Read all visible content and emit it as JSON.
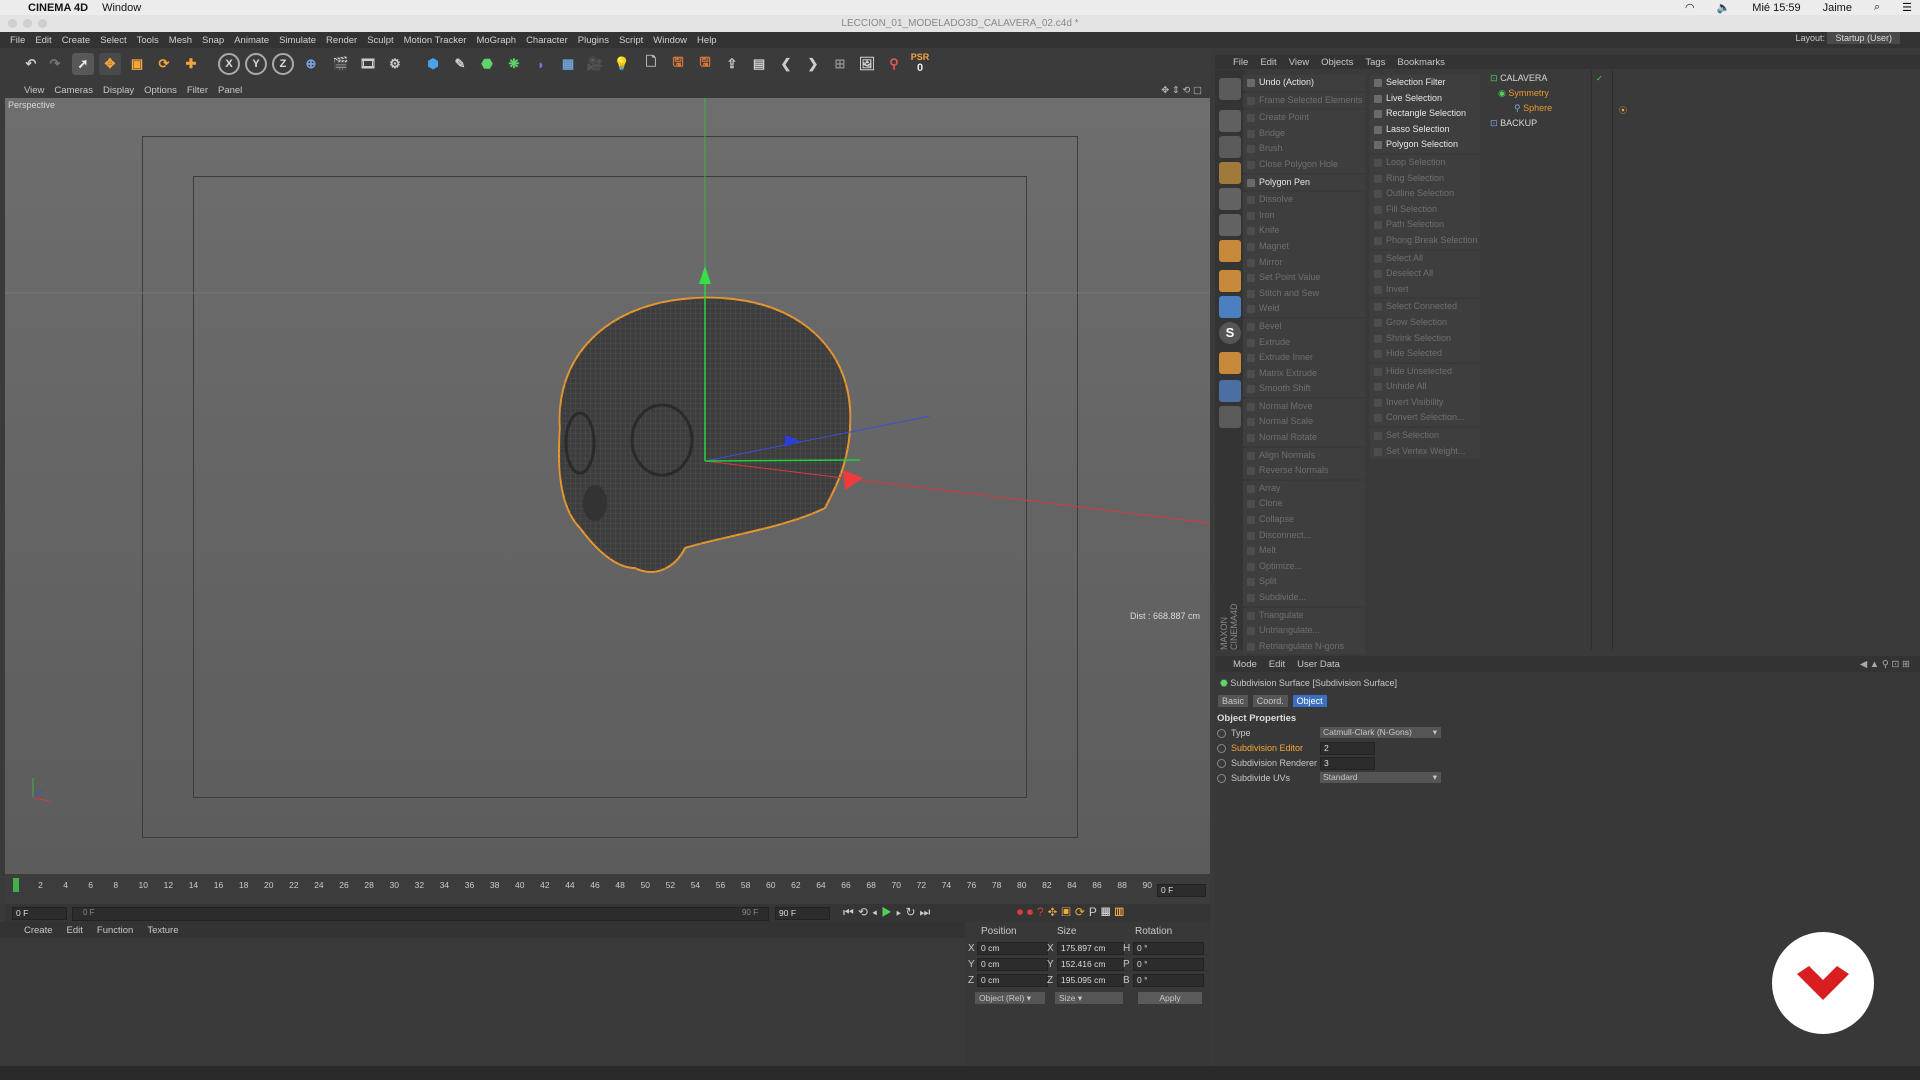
{
  "mac": {
    "app_name": "CINEMA 4D",
    "menu_window": "Window",
    "clock": "Mié 15:59",
    "user": "Jaime"
  },
  "window": {
    "title": "LECCION_01_MODELADO3D_CALAVERA_02.c4d *"
  },
  "app_menu": [
    "File",
    "Edit",
    "Create",
    "Select",
    "Tools",
    "Mesh",
    "Snap",
    "Animate",
    "Simulate",
    "Render",
    "Sculpt",
    "Motion Tracker",
    "MoGraph",
    "Character",
    "Plugins",
    "Script",
    "Window",
    "Help"
  ],
  "layout": {
    "label": "Layout:",
    "value": "Startup (User)"
  },
  "toolbar": {
    "psr_label": "PSR",
    "psr_value": "0"
  },
  "viewport_menu": [
    "View",
    "Cameras",
    "Display",
    "Options",
    "Filter",
    "Panel"
  ],
  "viewport": {
    "name": "Perspective",
    "distance": "Dist : 668.887 cm"
  },
  "timeline": {
    "ticks": [
      "0",
      "2",
      "4",
      "6",
      "8",
      "10",
      "12",
      "14",
      "16",
      "18",
      "20",
      "22",
      "24",
      "26",
      "28",
      "30",
      "32",
      "34",
      "36",
      "38",
      "40",
      "42",
      "44",
      "46",
      "48",
      "50",
      "52",
      "54",
      "56",
      "58",
      "60",
      "62",
      "64",
      "66",
      "68",
      "70",
      "72",
      "74",
      "76",
      "78",
      "80",
      "82",
      "84",
      "86",
      "88",
      "90"
    ],
    "current_frame": "0 F",
    "start": "0 F",
    "range_start": "0 F",
    "range_end": "90 F",
    "end": "90 F"
  },
  "material_menu": [
    "Create",
    "Edit",
    "Function",
    "Texture"
  ],
  "coords": {
    "headers": [
      "Position",
      "Size",
      "Rotation"
    ],
    "rows": [
      {
        "axis": "X",
        "pos": "0 cm",
        "saxis": "X",
        "size": "175.897 cm",
        "raxis": "H",
        "rot": "0 °"
      },
      {
        "axis": "Y",
        "pos": "0 cm",
        "saxis": "Y",
        "size": "152.416 cm",
        "raxis": "P",
        "rot": "0 °"
      },
      {
        "axis": "Z",
        "pos": "0 cm",
        "saxis": "Z",
        "size": "195.095 cm",
        "raxis": "B",
        "rot": "0 °"
      }
    ],
    "mode": "Object (Rel)",
    "size_mode": "Size",
    "apply": "Apply"
  },
  "right_menu": [
    "File",
    "Edit",
    "View",
    "Objects",
    "Tags",
    "Bookmarks"
  ],
  "mesh_commands": {
    "col1": [
      {
        "label": "Undo (Action)",
        "on": true
      },
      {
        "label": "Frame Selected Elements",
        "on": false
      },
      {
        "label": "Create Point",
        "on": false
      },
      {
        "label": "Bridge",
        "on": false
      },
      {
        "label": "Brush",
        "on": false
      },
      {
        "label": "Close Polygon Hole",
        "on": false
      },
      {
        "label": "Polygon Pen",
        "on": true
      },
      {
        "label": "Dissolve",
        "on": false
      },
      {
        "label": "Iron",
        "on": false
      },
      {
        "label": "Knife",
        "on": false
      },
      {
        "label": "Magnet",
        "on": false
      },
      {
        "label": "Mirror",
        "on": false
      },
      {
        "label": "Set Point Value",
        "on": false
      },
      {
        "label": "Stitch and Sew",
        "on": false
      },
      {
        "label": "Weld",
        "on": false
      },
      {
        "label": "Bevel",
        "on": false
      },
      {
        "label": "Extrude",
        "on": false
      },
      {
        "label": "Extrude Inner",
        "on": false
      },
      {
        "label": "Matrix Extrude",
        "on": false
      },
      {
        "label": "Smooth Shift",
        "on": false
      },
      {
        "label": "Normal Move",
        "on": false
      },
      {
        "label": "Normal Scale",
        "on": false
      },
      {
        "label": "Normal Rotate",
        "on": false
      },
      {
        "label": "Align Normals",
        "on": false
      },
      {
        "label": "Reverse Normals",
        "on": false
      },
      {
        "label": "Array",
        "on": false
      },
      {
        "label": "Clone",
        "on": false
      },
      {
        "label": "Collapse",
        "on": false
      },
      {
        "label": "Disconnect...",
        "on": false
      },
      {
        "label": "Melt",
        "on": false
      },
      {
        "label": "Optimize...",
        "on": false
      },
      {
        "label": "Split",
        "on": false
      },
      {
        "label": "Subdivide...",
        "on": false
      },
      {
        "label": "Triangulate",
        "on": false
      },
      {
        "label": "Untriangulate...",
        "on": false
      },
      {
        "label": "Retriangulate N-gons",
        "on": false
      }
    ],
    "col2": [
      {
        "label": "Selection Filter",
        "on": true
      },
      {
        "label": "Live Selection",
        "on": true
      },
      {
        "label": "Rectangle Selection",
        "on": true
      },
      {
        "label": "Lasso Selection",
        "on": true
      },
      {
        "label": "Polygon Selection",
        "on": true
      },
      {
        "label": "Loop Selection",
        "on": false
      },
      {
        "label": "Ring Selection",
        "on": false
      },
      {
        "label": "Outline Selection",
        "on": false
      },
      {
        "label": "Fill Selection",
        "on": false
      },
      {
        "label": "Path Selection",
        "on": false
      },
      {
        "label": "Phong Break Selection",
        "on": false
      },
      {
        "label": "Select All",
        "on": false
      },
      {
        "label": "Deselect All",
        "on": false
      },
      {
        "label": "Invert",
        "on": false
      },
      {
        "label": "Select Connected",
        "on": false
      },
      {
        "label": "Grow Selection",
        "on": false
      },
      {
        "label": "Shrink Selection",
        "on": false
      },
      {
        "label": "Hide Selected",
        "on": false
      },
      {
        "label": "Hide Unselected",
        "on": false
      },
      {
        "label": "Unhide All",
        "on": false
      },
      {
        "label": "Invert Visibility",
        "on": false
      },
      {
        "label": "Convert Selection...",
        "on": false
      },
      {
        "label": "Set Selection",
        "on": false
      },
      {
        "label": "Set Vertex Weight...",
        "on": false
      }
    ]
  },
  "objects": [
    {
      "name": "CALAVERA",
      "color": "#d8d8d8"
    },
    {
      "name": "Symmetry",
      "color": "#e69a2e"
    },
    {
      "name": "Sphere",
      "color": "#e69a2e"
    },
    {
      "name": "BACKUP",
      "color": "#d8d8d8"
    }
  ],
  "attr_menu": [
    "Mode",
    "Edit",
    "User Data"
  ],
  "attributes": {
    "title": "Subdivision Surface [Subdivision Surface]",
    "tabs": [
      "Basic",
      "Coord.",
      "Object"
    ],
    "active_tab": "Object",
    "section": "Object Properties",
    "props": [
      {
        "label": "Type",
        "value": "Catmull-Clark (N-Gons)",
        "highlight": false
      },
      {
        "label": "Subdivision Editor",
        "value": "2",
        "highlight": true
      },
      {
        "label": "Subdivision Renderer",
        "value": "3",
        "highlight": false
      },
      {
        "label": "Subdivide UVs",
        "value": "Standard",
        "highlight": false
      }
    ]
  },
  "maxon_label": "MAXON CINEMA4D"
}
